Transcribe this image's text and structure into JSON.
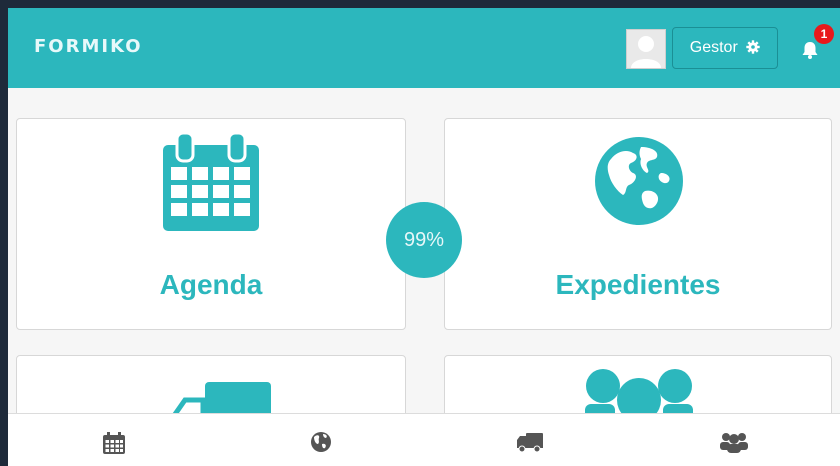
{
  "app": {
    "logo_text": "FORMIKO"
  },
  "header": {
    "user_button_label": "Gestor",
    "notifications_count": "1"
  },
  "cards": [
    {
      "label": "Agenda",
      "icon": "calendar-icon"
    },
    {
      "label": "Expedientes",
      "icon": "globe-icon"
    },
    {
      "label": "",
      "icon": "truck-icon"
    },
    {
      "label": "",
      "icon": "users-icon"
    }
  ],
  "progress": {
    "text": "99%"
  },
  "bottom_nav": [
    {
      "icon": "calendar-icon"
    },
    {
      "icon": "globe-icon"
    },
    {
      "icon": "truck-icon"
    },
    {
      "icon": "users-icon"
    }
  ],
  "colors": {
    "accent": "#2cb7bd",
    "badge": "#e8191c",
    "nav_icon": "#555555"
  }
}
